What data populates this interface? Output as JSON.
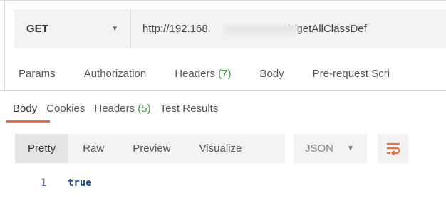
{
  "request": {
    "method": "GET",
    "url_prefix": "http://192.168.",
    "url_mid": "h",
    "url_suffix": "/getAllClassDef"
  },
  "request_tabs": [
    {
      "label": "Params"
    },
    {
      "label": "Authorization"
    },
    {
      "label": "Headers",
      "count": "(7)"
    },
    {
      "label": "Body"
    },
    {
      "label": "Pre-request Scri"
    }
  ],
  "response_tabs": [
    {
      "label": "Body"
    },
    {
      "label": "Cookies"
    },
    {
      "label": "Headers",
      "count": "(5)"
    },
    {
      "label": "Test Results"
    }
  ],
  "view_modes": [
    "Pretty",
    "Raw",
    "Preview",
    "Visualize"
  ],
  "format": "JSON",
  "code": {
    "line": "1",
    "value": "true"
  },
  "colors": {
    "accent": "#f26b3a",
    "count_green": "#3c9b3c",
    "code_blue": "#1a4e9a"
  },
  "icons": {
    "wrap": "wrap-lines-icon",
    "caret": "chevron-down-icon"
  }
}
